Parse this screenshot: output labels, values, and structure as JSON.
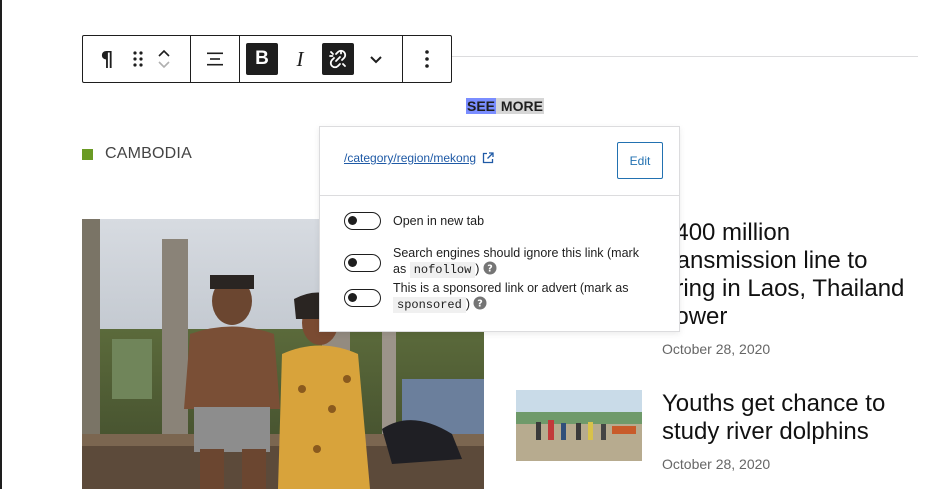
{
  "toolbar": {
    "buttons": [
      {
        "name": "paragraph",
        "icon": "pilcrow-icon",
        "glyph": "¶"
      },
      {
        "name": "drag",
        "icon": "drag-handle-icon"
      },
      {
        "name": "move",
        "icon": "chevron-up-down-icon"
      },
      {
        "name": "align",
        "icon": "align-center-icon"
      },
      {
        "name": "bold",
        "icon": "bold-icon",
        "glyph": "B"
      },
      {
        "name": "italic",
        "icon": "italic-icon",
        "glyph": "I"
      },
      {
        "name": "unlink",
        "icon": "link-off-icon"
      },
      {
        "name": "more-rich-text",
        "icon": "chevron-down-icon"
      },
      {
        "name": "options",
        "icon": "more-vertical-icon"
      }
    ]
  },
  "content": {
    "see_more_selected": "SEE",
    "see_more_rest": " MORE",
    "category": "CAMBODIA",
    "category_color": "#6a9a24"
  },
  "link_popover": {
    "url": "/category/region/mekong",
    "edit_label": "Edit",
    "options": [
      {
        "label": "Open in new tab",
        "checked": false
      },
      {
        "label_before": "Search engines should ignore this link (mark as",
        "code": "nofollow",
        "label_after": ")",
        "checked": false
      },
      {
        "label_before": "This is a sponsored link or advert (mark as",
        "code": "sponsored",
        "label_after": ")",
        "checked": false
      }
    ]
  },
  "articles": [
    {
      "title": "$400 million transmission line to bring in Laos, Thailand power",
      "date": "October 28, 2020"
    },
    {
      "title": "Youths get chance to study river dolphins",
      "date": "October 28, 2020"
    }
  ],
  "colors": {
    "accent": "#2271b1",
    "link": "#1f5aa6",
    "selection": "#7a8dff"
  }
}
